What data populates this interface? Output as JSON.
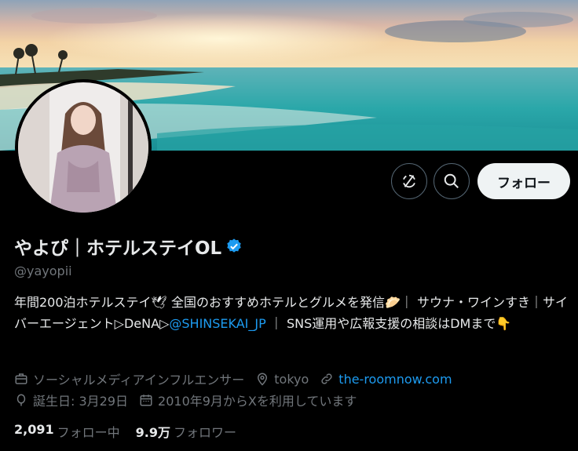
{
  "profile": {
    "display_name": "やよぴ｜ホテルステイOL",
    "handle": "@yayopii",
    "bio": {
      "text_1": "年間200泊ホテルステイ🕊 全国のおすすめホテルとグルメを発信🥟｜ サウナ・ワインすき｜サイバーエージェント▷DeNA▷",
      "mention": "@SHINSEKAI_JP",
      "text_2": " ｜ SNS運用や広報支援の相談はDMまで👇"
    },
    "category": "ソーシャルメディアインフルエンサー",
    "location": "tokyo",
    "website": "the-roomnow.com",
    "birthday": "誕生日: 3月29日",
    "joined": "2010年9月からXを利用しています"
  },
  "stats": {
    "following_count": "2,091",
    "following_label": "フォロー中",
    "followers_count": "9.9万",
    "followers_label": "フォロワー"
  },
  "actions": {
    "follow_label": "フォロー"
  },
  "icons": {
    "verified": "verified-badge-icon",
    "subscribe": "no-notification-icon",
    "search": "search-icon",
    "category": "briefcase-icon",
    "location": "location-pin-icon",
    "website": "link-icon",
    "birthday": "balloon-icon",
    "joined": "calendar-icon"
  },
  "colors": {
    "background": "#000000",
    "link": "#1d9bf0",
    "muted": "#71767b",
    "verified": "#1d9bf0"
  }
}
